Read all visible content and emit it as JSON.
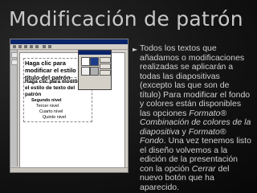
{
  "title": "Modificación de patrón",
  "screenshot": {
    "slide_title": "Haga clic para modificar el estilo de título del patrón",
    "body_levels": [
      "Haga clic para modificar el estilo de texto del patrón",
      "Segundo nivel",
      "Tercer nivel",
      "Cuarto nivel",
      "Quinto nivel"
    ]
  },
  "bullet": {
    "text_1": "Todos los textos que añadamos o modificaciones realizadas se aplicarán a todas las diapositivas (excepto las que son de título) Para modificar el fondo y colores están disponibles las opciones ",
    "em_1": "Formato® Combinación de colores de la diapositiva",
    "text_2": " y ",
    "em_2": "Formato® Fondo",
    "text_3": ". Una vez tenemos listo el diseño volvemos a la edición de la presentación con la opción ",
    "em_3": "Cerrar",
    "text_4": " del nuevo botón que ha aparecido."
  },
  "colors": {
    "background": "#0d0d0d",
    "title": "#c8c8c8",
    "text": "#d0d0d0",
    "window_titlebar": "#0a246a"
  }
}
